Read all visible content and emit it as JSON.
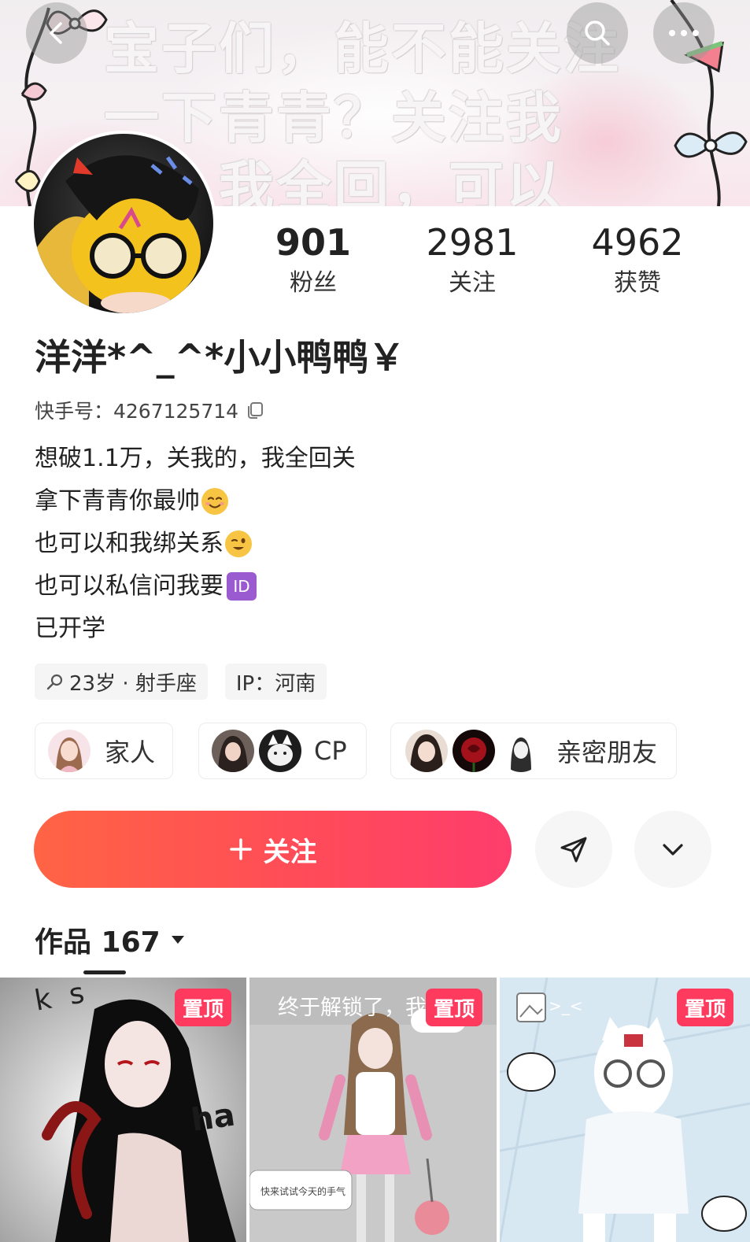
{
  "banner": {
    "text": "宝子们，能不能关注一下青青？关注我的，我全回，可以吗？"
  },
  "stats": {
    "fans": {
      "value": "901",
      "label": "粉丝"
    },
    "following": {
      "value": "2981",
      "label": "关注"
    },
    "likes": {
      "value": "4962",
      "label": "获赞"
    }
  },
  "profile": {
    "nickname": "洋洋*^_^*小小鸭鸭￥",
    "uid": "快手号：4267125714",
    "bio": [
      "想破1.1万，关我的，我全回关",
      "拿下青青你最帅",
      "也可以和我绑关系",
      "也可以私信问我要",
      "已开学"
    ],
    "bio_emoji": [
      "",
      "smiling-face-emoji",
      "winking-face-emoji",
      "id-button-emoji",
      ""
    ],
    "id_badge_text": "ID"
  },
  "tags": {
    "age_sign": "23岁 · 射手座",
    "ip": "IP：河南"
  },
  "relations": [
    {
      "label": "家人"
    },
    {
      "label": "CP"
    },
    {
      "label": "亲密朋友"
    }
  ],
  "actions": {
    "follow_label": "关注",
    "follow_icon": "plus-icon",
    "share_icon": "send-icon",
    "expand_icon": "chevron-down-icon"
  },
  "works": {
    "label": "作品 167",
    "items": [
      {
        "pin": "置顶",
        "overlay_text": "k s"
      },
      {
        "pin": "置顶",
        "overlay_text": "终于解锁了，我"
      },
      {
        "pin": "置顶",
        "overlay_text": ">_<"
      }
    ]
  },
  "colors": {
    "accent": "#fe4a55",
    "pin": "#fe3b5f"
  }
}
